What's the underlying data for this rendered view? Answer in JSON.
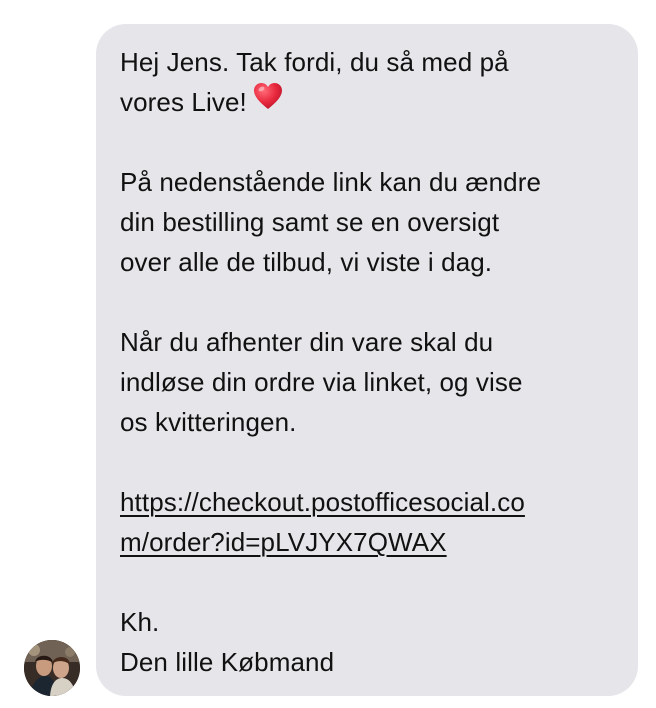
{
  "message": {
    "line1": "Hej Jens. Tak fordi, du så med på",
    "line2": "vores Live!",
    "heart_icon": "red-heart-emoji",
    "para2": [
      "På nedenstående link kan du ændre",
      "din bestilling samt se en oversigt",
      "over alle de tilbud, vi viste i dag."
    ],
    "para3": [
      "Når du afhenter din vare skal du",
      "indløse din ordre via linket, og vise",
      "os kvitteringen."
    ],
    "link": [
      "https://checkout.postofficesocial.co",
      "m/order?id=pLVJYX7QWAX"
    ],
    "signoff": "Kh.",
    "signature": "Den lille Købmand"
  },
  "colors": {
    "bubble_background": "#e6e6ea",
    "text": "#111111",
    "heart": "#e0243a"
  }
}
